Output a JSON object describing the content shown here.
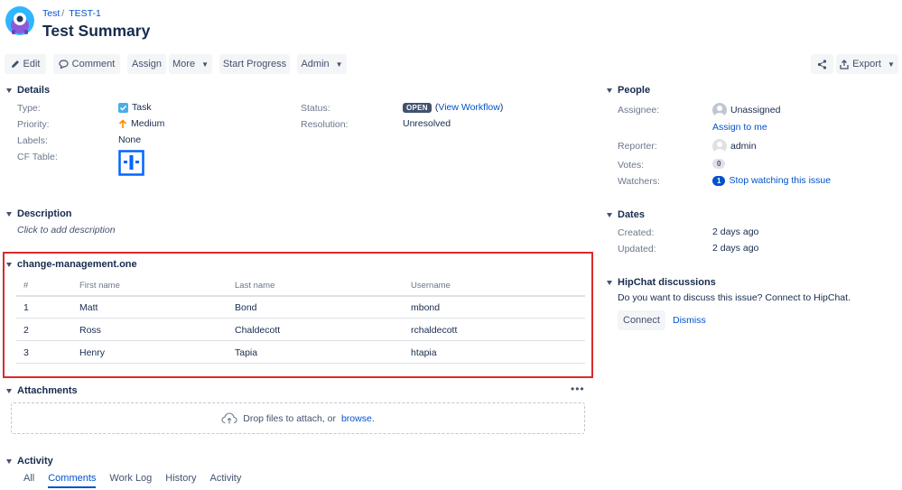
{
  "breadcrumb": {
    "project": "Test",
    "issue_key": "TEST-1"
  },
  "issue": {
    "title": "Test Summary"
  },
  "toolbar": {
    "edit": "Edit",
    "comment": "Comment",
    "assign": "Assign",
    "more": "More",
    "start_progress": "Start Progress",
    "admin": "Admin",
    "export": "Export"
  },
  "details": {
    "heading": "Details",
    "type_label": "Type:",
    "type_value": "Task",
    "priority_label": "Priority:",
    "priority_value": "Medium",
    "labels_label": "Labels:",
    "labels_value": "None",
    "cf_table_label": "CF Table:",
    "status_label": "Status:",
    "status_value": "OPEN",
    "view_workflow": "View Workflow",
    "resolution_label": "Resolution:",
    "resolution_value": "Unresolved"
  },
  "description": {
    "heading": "Description",
    "placeholder": "Click to add description"
  },
  "change_management": {
    "heading": "change-management.one",
    "columns": [
      "#",
      "First name",
      "Last name",
      "Username"
    ],
    "rows": [
      [
        "1",
        "Matt",
        "Bond",
        "mbond"
      ],
      [
        "2",
        "Ross",
        "Chaldecott",
        "rchaldecott"
      ],
      [
        "3",
        "Henry",
        "Tapia",
        "htapia"
      ]
    ]
  },
  "attachments": {
    "heading": "Attachments",
    "drop_text": "Drop files to attach, or",
    "browse": "browse."
  },
  "activity": {
    "heading": "Activity",
    "tabs": [
      "All",
      "Comments",
      "Work Log",
      "History",
      "Activity"
    ],
    "active_tab": "Comments"
  },
  "people": {
    "heading": "People",
    "assignee_label": "Assignee:",
    "assignee_value": "Unassigned",
    "assign_to_me": "Assign to me",
    "reporter_label": "Reporter:",
    "reporter_value": "admin",
    "votes_label": "Votes:",
    "votes_count": "0",
    "watchers_label": "Watchers:",
    "watchers_count": "1",
    "stop_watching": "Stop watching this issue"
  },
  "dates": {
    "heading": "Dates",
    "created_label": "Created:",
    "created_value": "2 days ago",
    "updated_label": "Updated:",
    "updated_value": "2 days ago"
  },
  "hipchat": {
    "heading": "HipChat discussions",
    "prompt": "Do you want to discuss this issue? Connect to HipChat.",
    "connect": "Connect",
    "dismiss": "Dismiss"
  },
  "colors": {
    "accent": "#0052cc",
    "highlight_border": "#d92b2b",
    "task_icon": "#4bade8",
    "priority_medium": "#ff8b00"
  }
}
